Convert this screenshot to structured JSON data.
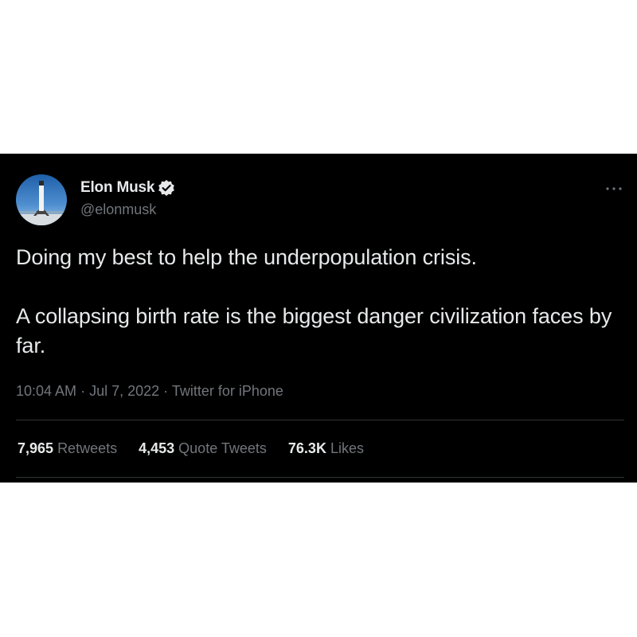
{
  "author": {
    "display_name": "Elon Musk",
    "handle": "@elonmusk",
    "verified": true
  },
  "tweet": {
    "paragraphs": [
      "Doing my best to help the underpopulation crisis.",
      "A collapsing birth rate is the biggest danger civilization faces by far."
    ],
    "time": "10:04 AM",
    "date": "Jul 7, 2022",
    "source": "Twitter for iPhone",
    "separator": " · "
  },
  "stats": {
    "retweets": {
      "count": "7,965",
      "label": "Retweets"
    },
    "quote_tweets": {
      "count": "4,453",
      "label": "Quote Tweets"
    },
    "likes": {
      "count": "76.3K",
      "label": "Likes"
    }
  },
  "icons": {
    "verified": "verified-badge-icon",
    "more": "more-options-icon"
  },
  "colors": {
    "background": "#000000",
    "page": "#ffffff",
    "primary_text": "#e7e9ea",
    "secondary_text": "#71767b",
    "divider": "#2f3336"
  }
}
